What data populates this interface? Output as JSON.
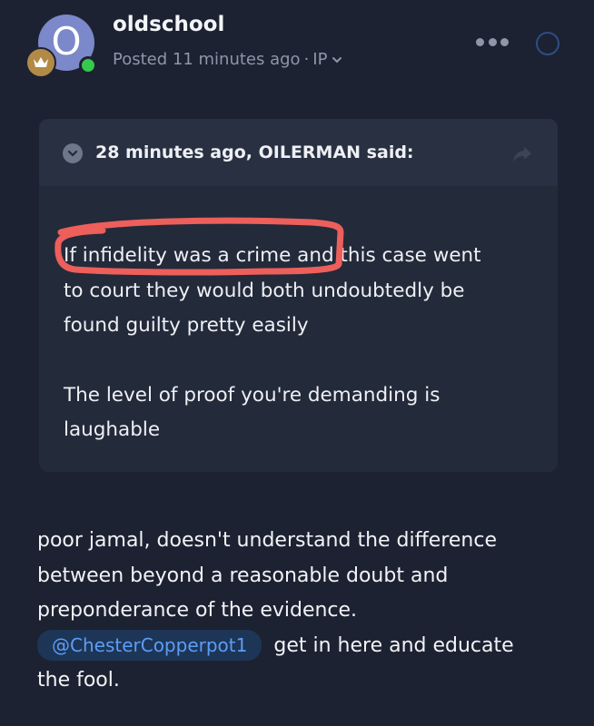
{
  "post": {
    "avatar_letter": "O",
    "username": "oldschool",
    "posted_text": "Posted 11 minutes ago",
    "separator": "·",
    "ip_label": "IP",
    "icons": {
      "rank": "crown-icon",
      "more": "more-dots-icon",
      "select": "select-circle-icon",
      "ip_dropdown": "chevron-down-icon"
    },
    "colors": {
      "background": "#1c2231",
      "avatar": "#7b88c9",
      "online": "#35c94d",
      "rank_badge": "#b28a47",
      "quote_bg": "#232a3a",
      "mention_bg": "#1d3557",
      "mention_text": "#5c9ef5",
      "annotation": "#ec5f5b"
    }
  },
  "quote": {
    "attribution": "28 minutes ago, OILERMAN said:",
    "toggle_icon": "chevron-down-circle-icon",
    "share_icon": "share-arrow-icon",
    "lines": [
      "If infidelity was a crime and this case went",
      "to court they would both undoubtedly be",
      "found guilty pretty easily"
    ],
    "lines2": [
      "The level of proof you're demanding is",
      "laughable"
    ]
  },
  "reply": {
    "line1": "poor jamal, doesn't understand the difference",
    "line2": "between beyond a reasonable doubt and",
    "line3": "preponderance of the evidence.",
    "mention": "@ChesterCopperpot1",
    "after_mention": "get in here and educate",
    "line5": "the fool."
  }
}
